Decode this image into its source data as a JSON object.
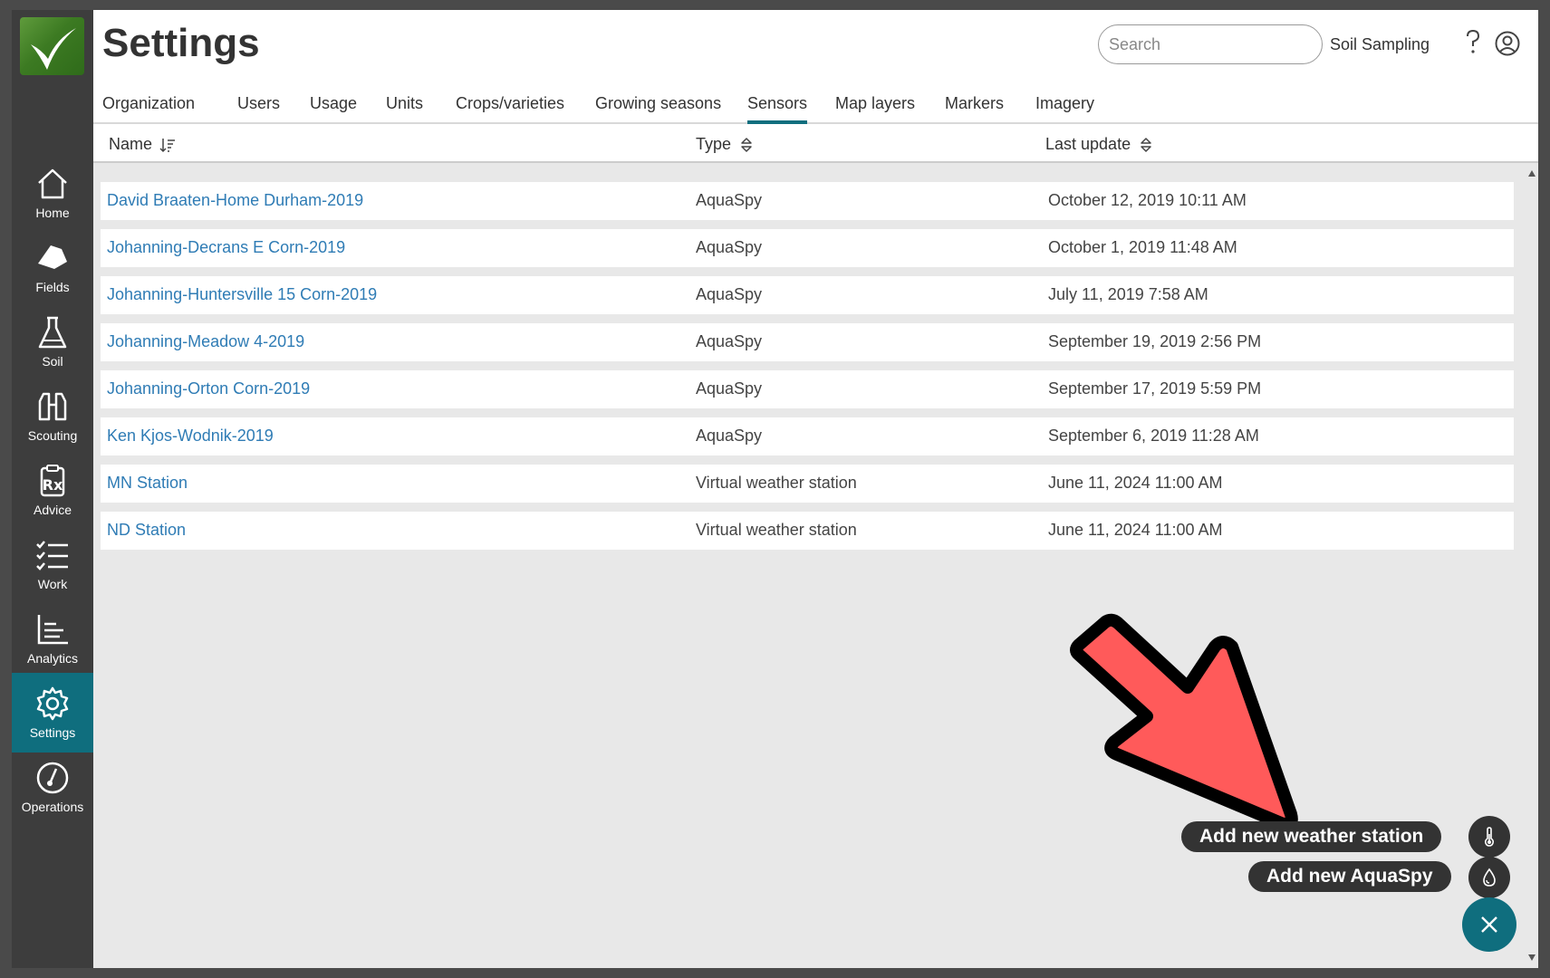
{
  "app": {
    "title": "Settings",
    "search_placeholder": "Search",
    "soil_sampling_label": "Soil Sampling"
  },
  "sidebar": {
    "items": [
      {
        "label": "Home",
        "icon": "home-icon"
      },
      {
        "label": "Fields",
        "icon": "fields-icon"
      },
      {
        "label": "Soil",
        "icon": "flask-icon"
      },
      {
        "label": "Scouting",
        "icon": "binoculars-icon"
      },
      {
        "label": "Advice",
        "icon": "prescription-icon"
      },
      {
        "label": "Work",
        "icon": "checklist-icon"
      },
      {
        "label": "Analytics",
        "icon": "analytics-icon"
      },
      {
        "label": "Settings",
        "icon": "gear-icon",
        "active": true
      },
      {
        "label": "Operations",
        "icon": "operations-icon"
      }
    ]
  },
  "tabs": [
    {
      "label": "Organization"
    },
    {
      "label": "Users"
    },
    {
      "label": "Usage"
    },
    {
      "label": "Units"
    },
    {
      "label": "Crops/varieties"
    },
    {
      "label": "Growing seasons"
    },
    {
      "label": "Sensors",
      "active": true
    },
    {
      "label": "Map layers"
    },
    {
      "label": "Markers"
    },
    {
      "label": "Imagery"
    }
  ],
  "table": {
    "columns": [
      "Name",
      "Type",
      "Last update"
    ],
    "rows": [
      {
        "name": "David Braaten-Home Durham-2019",
        "type": "AquaSpy",
        "updated": "October 12, 2019 10:11 AM"
      },
      {
        "name": "Johanning-Decrans E Corn-2019",
        "type": "AquaSpy",
        "updated": "October 1, 2019 11:48 AM"
      },
      {
        "name": "Johanning-Huntersville 15 Corn-2019",
        "type": "AquaSpy",
        "updated": "July 11, 2019 7:58 AM"
      },
      {
        "name": "Johanning-Meadow 4-2019",
        "type": "AquaSpy",
        "updated": "September 19, 2019 2:56 PM"
      },
      {
        "name": "Johanning-Orton Corn-2019",
        "type": "AquaSpy",
        "updated": "September 17, 2019 5:59 PM"
      },
      {
        "name": "Ken Kjos-Wodnik-2019",
        "type": "AquaSpy",
        "updated": "September 6, 2019 11:28 AM"
      },
      {
        "name": "MN Station",
        "type": "Virtual weather station",
        "updated": "June 11, 2024 11:00 AM"
      },
      {
        "name": "ND Station",
        "type": "Virtual weather station",
        "updated": "June 11, 2024 11:00 AM"
      }
    ]
  },
  "fab": {
    "add_weather_label": "Add new weather station",
    "add_aquaspy_label": "Add new AquaSpy"
  },
  "colors": {
    "accent": "#0f6e7e",
    "link": "#2f7cb5",
    "sidebar": "#3d3d3d",
    "annotation_arrow": "#ff5a5a"
  }
}
